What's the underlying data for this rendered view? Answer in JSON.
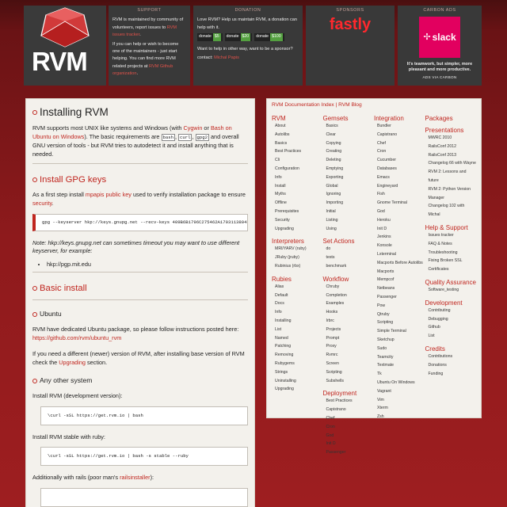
{
  "header": {
    "logo_text": "RVM",
    "support": {
      "title": "SUPPORT",
      "p1_a": "RVM is maintained by community of volunteers, report issues to ",
      "p1_link": "RVM issues tracker",
      "p1_b": ".",
      "p2_a": "If you can help or wish to become one of the maintainers - just start helping. You can find more RVM related projects at ",
      "p2_link": "RVM Github organization",
      "p2_b": "."
    },
    "donation": {
      "title": "DONATION",
      "p1": "Love RVM? Help us maintain RVM, a donation can help with it.",
      "buttons": [
        {
          "label": "donate",
          "amount": "$5"
        },
        {
          "label": "donate",
          "amount": "$20"
        },
        {
          "label": "donate",
          "amount": "$100"
        }
      ],
      "p2": "Want to help in other way, want to be a sponsor?",
      "contact_label": "contact: ",
      "contact_name": "Michal Papis"
    },
    "sponsors": {
      "title": "SPONSORS",
      "name": "fastly"
    },
    "carbon": {
      "title": "CARBON ADS",
      "ad_name": "slack",
      "ad_text": "It's teamwork, but simpler, more pleasant and more productive.",
      "via": "ADS VIA CARBON"
    }
  },
  "main": {
    "title": "Installing RVM",
    "intro_1": "RVM supports most UNIX like systems and Windows (with ",
    "cygwin": "Cygwin",
    "or": " or ",
    "bash_ubuntu": "Bash on Ubuntu on Windows",
    "intro_2": "). The basic requirements are ",
    "req1": "bash",
    "req2": "curl",
    "req3": "gpg2",
    "intro_3": " and overall GNU version of tools - but RVM tries to autodetect it and install anything that is needed.",
    "gpg_heading": "Install GPG keys",
    "gpg_p_a": "As a first step install ",
    "gpg_link": "mpapis public key",
    "gpg_p_b": " used to verify installation package to ensure ",
    "gpg_link2": "security",
    "gpg_p_c": ".",
    "gpg_cmd": "gpg --keyserver hkp://keys.gnupg.net --recv-keys 409B6B1796C275462A1703113804BB82D39DC0E3 7D2BAF1CF37B13E2069D6956105BD0E739499BDB",
    "note": "Note: hkp://keys.gnupg.net can sometimes timeout you may want to use different keyserver, for example:",
    "keyserver": "hkp://pgp.mit.edu",
    "basic_heading": "Basic install",
    "ubuntu_heading": "Ubuntu",
    "ubuntu_p": "RVM have dedicated Ubuntu package, so please follow instructions posted here: ",
    "ubuntu_link": "https://github.com/rvm/ubuntu_rvm",
    "ubuntu_p2_a": "If you need a different (newer) version of RVM, after installing base version of RVM check the ",
    "ubuntu_link2": "Upgrading",
    "ubuntu_p2_b": " section.",
    "other_heading": "Any other system",
    "dev_label": "Install RVM (development version):",
    "dev_cmd": "\\curl -sSL https://get.rvm.io | bash",
    "stable_label": "Install RVM stable with ruby:",
    "stable_cmd": "\\curl -sSL https://get.rvm.io | bash -s stable --ruby",
    "rails_a": "Additionally with rails (poor man's ",
    "rails_link": "railsinstaller",
    "rails_b": "):"
  },
  "side": {
    "doc_index": "RVM Documentation Index",
    "sep": " | ",
    "blog": "RVM Blog",
    "columns": [
      [
        {
          "h": "RVM",
          "items": [
            "About",
            "Autolibs",
            "Basics",
            "Best Practices",
            "Cli",
            "Configuration",
            "Info",
            "Install",
            "Myths",
            "Offline",
            "Prerequisites",
            "Security",
            "Upgrading"
          ]
        },
        {
          "h": "Interpreters",
          "items": [
            "MRI/YARV (ruby)",
            "JRuby (jruby)",
            "Rubinius (rbx)"
          ]
        },
        {
          "h": "Rubies",
          "items": [
            "Alias",
            "Default",
            "Docs",
            "Info",
            "Installing",
            "List",
            "Named",
            "Patching",
            "Removing",
            "Rubygems",
            "Strings",
            "Uninstalling",
            "Upgrading"
          ]
        }
      ],
      [
        {
          "h": "Gemsets",
          "items": [
            "Basics",
            "Clear",
            "Copying",
            "Creating",
            "Deleting",
            "Emptying",
            "Exporting",
            "Global",
            "Ignoring",
            "Importing",
            "Initial",
            "Listing",
            "Using"
          ]
        },
        {
          "h": "Set Actions",
          "items": [
            "do",
            "tests",
            "benchmark"
          ]
        },
        {
          "h": "Workflow",
          "items": [
            "Chruby",
            "Completion",
            "Examples",
            "Hooks",
            "Irbrc",
            "Projects",
            "Prompt",
            "Proxy",
            "Rvmrc",
            "Screen",
            "Scripting",
            "Subshells"
          ]
        },
        {
          "h": "Deployment",
          "items": [
            "Best Practices",
            "Capistrano",
            "Chef",
            "Cron",
            "God",
            "Init D",
            "Passenger"
          ]
        }
      ],
      [
        {
          "h": "Integration",
          "items": [
            "Bundler",
            "Capistrano",
            "Chef",
            "Cron",
            "Cucumber",
            "Databases",
            "Emacs",
            "Engineyard",
            "Fish",
            "Gnome Terminal",
            "God",
            "Heroku",
            "Init D",
            "Jenkins",
            "Konsole",
            "Lxterminal",
            "Macports Before Autolibs",
            "Macports",
            "Mempcof",
            "Netbeans",
            "Passenger",
            "Pow",
            "Qtruby",
            "Scripting",
            "Simple Terminal",
            "Sketchup",
            "Sudo",
            "Teamcity",
            "Textmate",
            "Tk",
            "Ubuntu On Windows",
            "Vagrant",
            "Vim",
            "Xterm",
            "Zsh"
          ]
        }
      ],
      [
        {
          "h": "Packages",
          "items": []
        },
        {
          "h": "Presentations",
          "items": [
            "MWRC 2010",
            "RailsConf 2012",
            "RailsConf 2013",
            "Changelog 66 with Wayne",
            "RVM 2: Lessons and future",
            "RVM 2: Python Version Manager",
            "Changelog 102 with Michal"
          ]
        },
        {
          "h": "Help & Support",
          "items": [
            "Issues tracker",
            "FAQ & Notes",
            "Troubleshooting",
            "Fixing Broken SSL",
            "Certificates"
          ]
        },
        {
          "h": "Quality Assurance",
          "items": [
            "Software_testing"
          ]
        },
        {
          "h": "Development",
          "items": [
            "Contributing",
            "Debugging",
            "Github",
            "List"
          ]
        },
        {
          "h": "Credits",
          "items": [
            "Contributions",
            "Donations",
            "Funding"
          ]
        }
      ]
    ]
  },
  "colors": {
    "accent": "#c0261f",
    "bg": "#8e1a1c",
    "panel": "#f3f1ec"
  }
}
